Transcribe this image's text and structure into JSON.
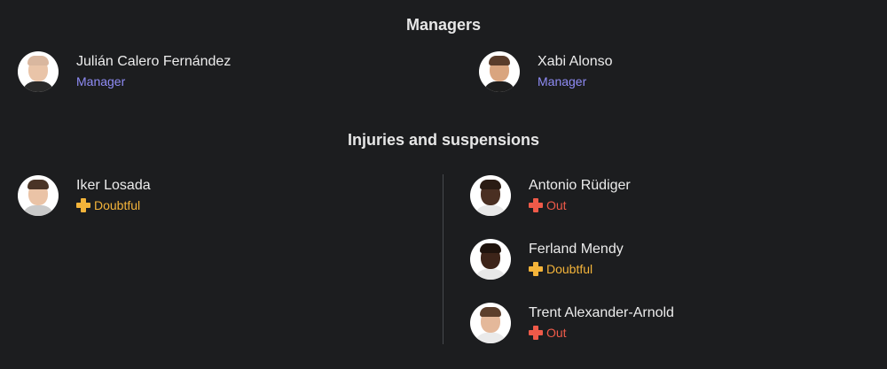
{
  "managers": {
    "title": "Managers",
    "left": {
      "name": "Julián Calero Fernández",
      "role": "Manager"
    },
    "right": {
      "name": "Xabi Alonso",
      "role": "Manager"
    }
  },
  "injuries": {
    "title": "Injuries and suspensions",
    "left": [
      {
        "name": "Iker Losada",
        "status": "Doubtful"
      }
    ],
    "right": [
      {
        "name": "Antonio Rüdiger",
        "status": "Out"
      },
      {
        "name": "Ferland Mendy",
        "status": "Doubtful"
      },
      {
        "name": "Trent Alexander-Arnold",
        "status": "Out"
      }
    ]
  },
  "colors": {
    "background": "#1c1d1f",
    "manager_role": "#8f8cf5",
    "doubtful": "#f4b43a",
    "out": "#ef5a49"
  },
  "icons": {
    "status": "medical-cross-icon"
  }
}
